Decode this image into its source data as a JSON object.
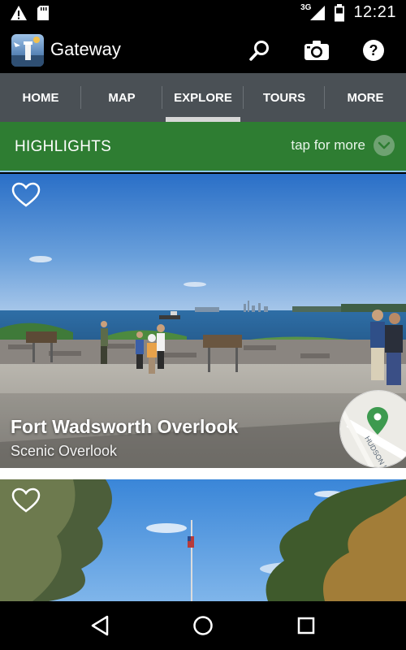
{
  "status_bar": {
    "time": "12:21",
    "network": "3G",
    "icons": [
      "warning-icon",
      "sd-card-icon",
      "signal-icon",
      "battery-icon"
    ]
  },
  "app_bar": {
    "title": "Gateway",
    "actions": [
      "search-icon",
      "camera-icon",
      "help-icon"
    ]
  },
  "tabs": [
    {
      "label": "HOME",
      "selected": false
    },
    {
      "label": "MAP",
      "selected": false
    },
    {
      "label": "EXPLORE",
      "selected": true
    },
    {
      "label": "TOURS",
      "selected": false
    },
    {
      "label": "MORE",
      "selected": false
    }
  ],
  "highlights": {
    "title": "HIGHLIGHTS",
    "more_label": "tap for more"
  },
  "cards": [
    {
      "title": "Fort Wadsworth Overlook",
      "subtitle": "Scenic Overlook",
      "map_label": "HUDSON R ST",
      "favorite_icon": "heart-outline-icon"
    },
    {
      "title": "",
      "subtitle": "",
      "favorite_icon": "heart-outline-icon"
    }
  ],
  "nav_bar": {
    "buttons": [
      "back-icon",
      "home-icon",
      "recents-icon"
    ]
  },
  "colors": {
    "accent_green": "#2e7d32",
    "tab_bar": "#4a5055",
    "status_bar": "#000000"
  }
}
